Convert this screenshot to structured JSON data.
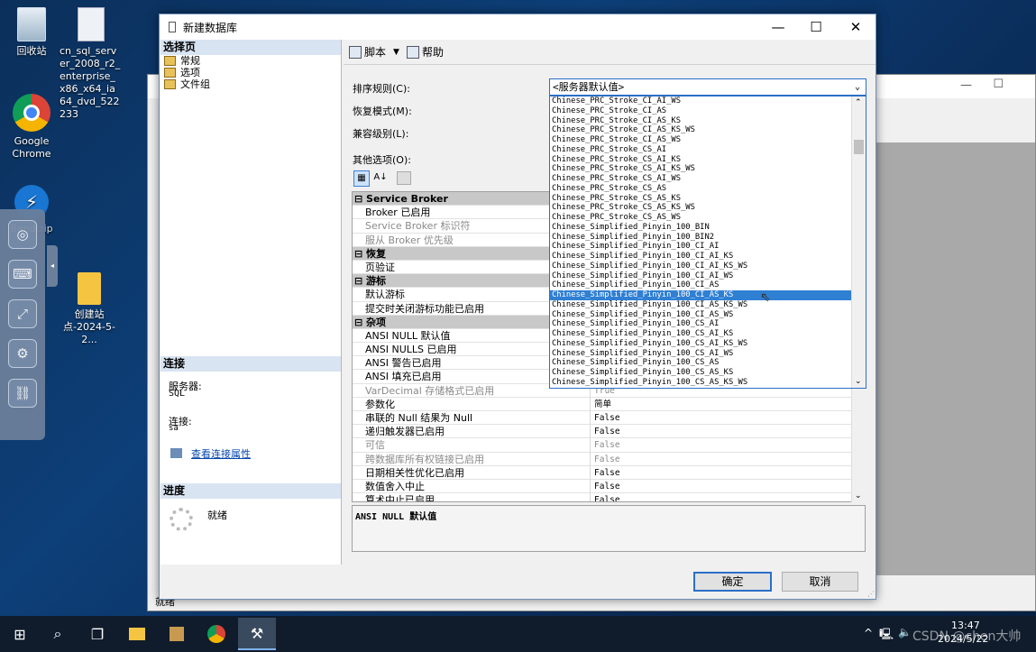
{
  "desktop": {
    "icons": [
      {
        "label": "回收站"
      },
      {
        "label": "cn_sql_server_2008_r2_enterprise_x86_x64_ia64_dvd_522233"
      },
      {
        "label": "Google Chrome"
      },
      {
        "label": "Bandizip"
      },
      {
        "label": "创建站点-2024-5-2..."
      }
    ]
  },
  "dialog": {
    "title": "新建数据库",
    "left_pane": {
      "select_page_header": "选择页",
      "pages": [
        "常规",
        "选项",
        "文件组"
      ],
      "connection_header": "连接",
      "server_label": "服务器:",
      "server_value": "SQL",
      "connection_label": "连接:",
      "connection_value": "sa",
      "view_connection_link": "查看连接属性",
      "progress_header": "进度",
      "progress_status": "就绪"
    },
    "toolbar": {
      "script_label": "脚本",
      "help_label": "帮助"
    },
    "form": {
      "collation_label": "排序规则(C):",
      "collation_value": "<服务器默认值>",
      "recovery_label": "恢复模式(M):",
      "compat_label": "兼容级别(L):",
      "other_options_label": "其他选项(O):"
    },
    "collation_options": [
      "Chinese_PRC_Stroke_CI_AI_WS",
      "Chinese_PRC_Stroke_CI_AS",
      "Chinese_PRC_Stroke_CI_AS_KS",
      "Chinese_PRC_Stroke_CI_AS_KS_WS",
      "Chinese_PRC_Stroke_CI_AS_WS",
      "Chinese_PRC_Stroke_CS_AI",
      "Chinese_PRC_Stroke_CS_AI_KS",
      "Chinese_PRC_Stroke_CS_AI_KS_WS",
      "Chinese_PRC_Stroke_CS_AI_WS",
      "Chinese_PRC_Stroke_CS_AS",
      "Chinese_PRC_Stroke_CS_AS_KS",
      "Chinese_PRC_Stroke_CS_AS_KS_WS",
      "Chinese_PRC_Stroke_CS_AS_WS",
      "Chinese_Simplified_Pinyin_100_BIN",
      "Chinese_Simplified_Pinyin_100_BIN2",
      "Chinese_Simplified_Pinyin_100_CI_AI",
      "Chinese_Simplified_Pinyin_100_CI_AI_KS",
      "Chinese_Simplified_Pinyin_100_CI_AI_KS_WS",
      "Chinese_Simplified_Pinyin_100_CI_AI_WS",
      "Chinese_Simplified_Pinyin_100_CI_AS",
      "Chinese_Simplified_Pinyin_100_CI_AS_KS",
      "Chinese_Simplified_Pinyin_100_CI_AS_KS_WS",
      "Chinese_Simplified_Pinyin_100_CI_AS_WS",
      "Chinese_Simplified_Pinyin_100_CS_AI",
      "Chinese_Simplified_Pinyin_100_CS_AI_KS",
      "Chinese_Simplified_Pinyin_100_CS_AI_KS_WS",
      "Chinese_Simplified_Pinyin_100_CS_AI_WS",
      "Chinese_Simplified_Pinyin_100_CS_AS",
      "Chinese_Simplified_Pinyin_100_CS_AS_KS",
      "Chinese_Simplified_Pinyin_100_CS_AS_KS_WS"
    ],
    "selected_option_index": 20,
    "properties": [
      {
        "type": "cat",
        "key": "Service Broker"
      },
      {
        "key": "Broker 已启用",
        "value": ""
      },
      {
        "key": "Service Broker 标识符",
        "value": "",
        "dim": true
      },
      {
        "key": "服从 Broker 优先级",
        "value": "",
        "dim": true
      },
      {
        "type": "cat",
        "key": "恢复"
      },
      {
        "key": "页验证",
        "value": ""
      },
      {
        "type": "cat",
        "key": "游标"
      },
      {
        "key": "默认游标",
        "value": ""
      },
      {
        "key": "提交时关闭游标功能已启用",
        "value": ""
      },
      {
        "type": "cat",
        "key": "杂项"
      },
      {
        "key": "ANSI NULL 默认值",
        "value": ""
      },
      {
        "key": "ANSI NULLS 已启用",
        "value": ""
      },
      {
        "key": "ANSI 警告已启用",
        "value": ""
      },
      {
        "key": "ANSI 填充已启用",
        "value": ""
      },
      {
        "key": "VarDecimal 存储格式已启用",
        "value": "True",
        "dim": true
      },
      {
        "key": "参数化",
        "value": "简单"
      },
      {
        "key": "串联的 Null 结果为 Null",
        "value": "False"
      },
      {
        "key": "递归触发器已启用",
        "value": "False"
      },
      {
        "key": "可信",
        "value": "False",
        "dim": true
      },
      {
        "key": "跨数据库所有权链接已启用",
        "value": "False",
        "dim": true
      },
      {
        "key": "日期相关性优化已启用",
        "value": "False"
      },
      {
        "key": "数值舍入中止",
        "value": "False"
      },
      {
        "key": "算术中止已启用",
        "value": "False"
      }
    ],
    "description": "ANSI NULL 默认值",
    "ok_label": "确定",
    "cancel_label": "取消"
  },
  "background_window": {
    "status_text": "就绪"
  },
  "taskbar": {
    "clock_time": "13:47",
    "clock_date": "2024/5/22",
    "watermark": "CSDN @chen大帅"
  }
}
